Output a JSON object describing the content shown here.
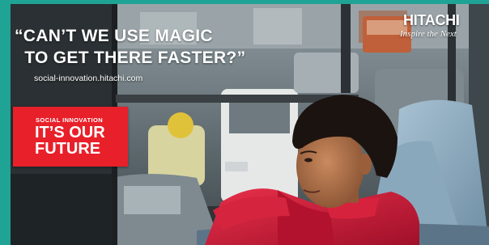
{
  "ad": {
    "headline": "“CAN’T WE USE MAGIC\n  TO GET THERE FASTER?”",
    "url": "social-innovation.hitachi.com",
    "brand": {
      "name": "HITACHI",
      "tagline": "Inspire the Next"
    },
    "badge": {
      "small": "SOCIAL INNOVATION",
      "line1": "IT’S OUR",
      "line2": "FUTURE"
    }
  },
  "colors": {
    "frame": "#1fa394",
    "badge": "#e8202a",
    "text": "#ffffff"
  }
}
